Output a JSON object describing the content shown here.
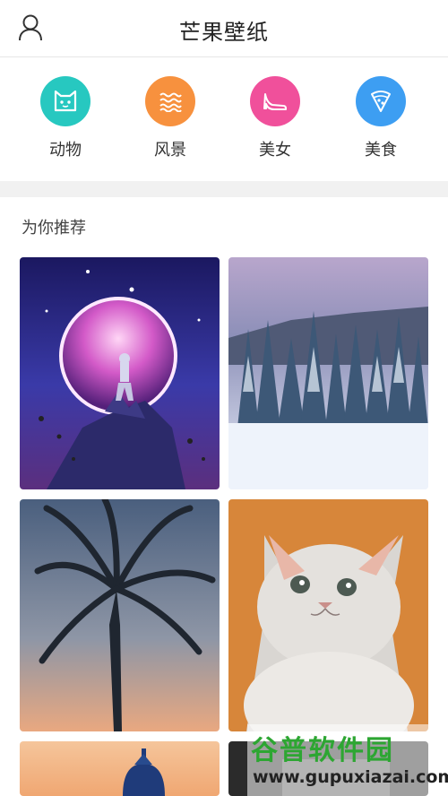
{
  "header": {
    "title": "芒果壁纸",
    "user_icon": "user-icon"
  },
  "categories": [
    {
      "label": "动物",
      "icon": "cat-icon",
      "color": "#27c8c0"
    },
    {
      "label": "风景",
      "icon": "waves-icon",
      "color": "#f7913e"
    },
    {
      "label": "美女",
      "icon": "high-heel-icon",
      "color": "#f0509b"
    },
    {
      "label": "美食",
      "icon": "pizza-icon",
      "color": "#3d9ef2"
    }
  ],
  "recommend": {
    "title": "为你推荐",
    "items": [
      {
        "name": "astronaut-planet-wallpaper"
      },
      {
        "name": "snowy-forest-wallpaper"
      },
      {
        "name": "palm-tree-wallpaper"
      },
      {
        "name": "kitten-wallpaper"
      },
      {
        "name": "cathedral-dome-wallpaper"
      },
      {
        "name": "partial-wallpaper"
      }
    ]
  },
  "watermark": {
    "title": "谷普软件园",
    "url": "www.gupuxiazai.com"
  }
}
